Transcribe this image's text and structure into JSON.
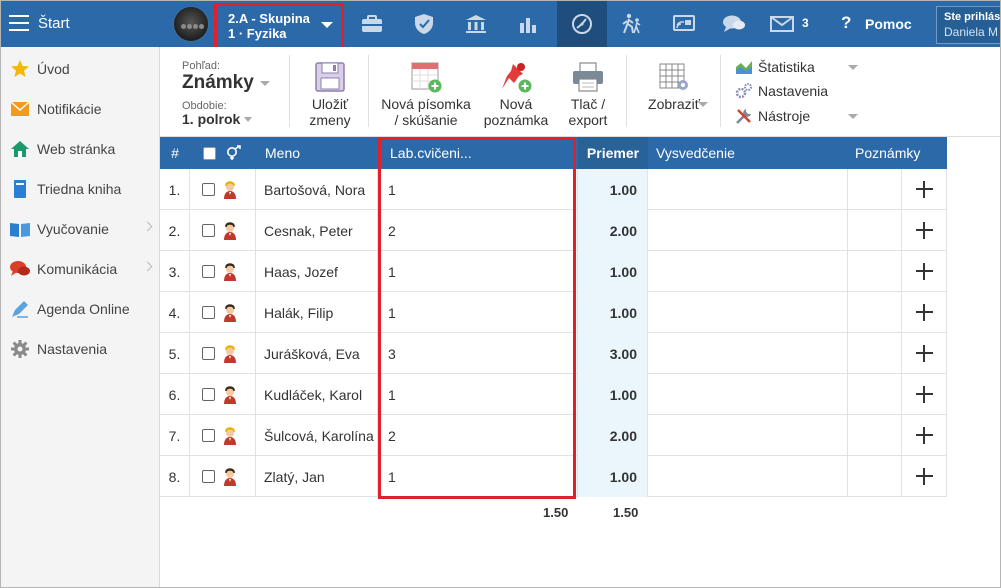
{
  "topbar": {
    "start_label": "Štart",
    "group_line1": "2.A - Skupina",
    "group_line2": "1 · Fyzika",
    "mail_count": "3",
    "help_label": "Pomoc",
    "user_line1": "Ste prihlás",
    "user_line2": "Daniela M",
    "accent_color": "#2b69a8",
    "highlight_color": "#e0202a",
    "icons": [
      "briefcase-icon",
      "shield-icon",
      "bank-icon",
      "bar-chart-icon",
      "gauge-icon",
      "walking-icon",
      "cast-icon",
      "chat-icon",
      "mail-icon",
      "help-icon"
    ]
  },
  "sidebar": {
    "items": [
      {
        "label": "Úvod",
        "icon": "star-icon",
        "has_submenu": false
      },
      {
        "label": "Notifikácie",
        "icon": "envelope-icon",
        "has_submenu": false
      },
      {
        "label": "Web stránka",
        "icon": "home-icon",
        "has_submenu": false
      },
      {
        "label": "Triedna kniha",
        "icon": "book-icon",
        "has_submenu": false
      },
      {
        "label": "Vyučovanie",
        "icon": "open-book-icon",
        "has_submenu": true
      },
      {
        "label": "Komunikácia",
        "icon": "chat-bubbles-icon",
        "has_submenu": true
      },
      {
        "label": "Agenda Online",
        "icon": "pen-icon",
        "has_submenu": false
      },
      {
        "label": "Nastavenia",
        "icon": "gear-icon",
        "has_submenu": false
      }
    ]
  },
  "ribbon": {
    "view_label": "Pohľad:",
    "view_value": "Známky",
    "period_label": "Obdobie:",
    "period_value": "1. polrok",
    "save_line1": "Uložiť",
    "save_line2": "zmeny",
    "new_test_line1": "Nová písomka",
    "new_test_line2": "/ skúšanie",
    "new_note_line1": "Nová",
    "new_note_line2": "poznámka",
    "print_line1": "Tlač /",
    "print_line2": "export",
    "show_label": "Zobraziť",
    "stats_label": "Štatistika",
    "settings_label": "Nastavenia",
    "tools_label": "Nástroje"
  },
  "grid": {
    "headers": {
      "num": "#",
      "name": "Meno",
      "lab": "Lab.cvičeni...",
      "avg": "Priemer",
      "report": "Vysvedčenie",
      "notes": "Poznámky"
    },
    "rows": [
      {
        "num": "1.",
        "name": "Bartošová, Nora",
        "lab": "1",
        "avg": "1.00",
        "gender": "female"
      },
      {
        "num": "2.",
        "name": "Cesnak, Peter",
        "lab": "2",
        "avg": "2.00",
        "gender": "male"
      },
      {
        "num": "3.",
        "name": "Haas, Jozef",
        "lab": "1",
        "avg": "1.00",
        "gender": "male"
      },
      {
        "num": "4.",
        "name": "Halák, Filip",
        "lab": "1",
        "avg": "1.00",
        "gender": "male"
      },
      {
        "num": "5.",
        "name": "Jurášková, Eva",
        "lab": "3",
        "avg": "3.00",
        "gender": "female"
      },
      {
        "num": "6.",
        "name": "Kudláček, Karol",
        "lab": "1",
        "avg": "1.00",
        "gender": "male"
      },
      {
        "num": "7.",
        "name": "Šulcová, Karolína",
        "lab": "2",
        "avg": "2.00",
        "gender": "female"
      },
      {
        "num": "8.",
        "name": "Zlatý, Jan",
        "lab": "1",
        "avg": "1.00",
        "gender": "male"
      }
    ],
    "footer": {
      "lab_avg": "1.50",
      "overall_avg": "1.50"
    }
  }
}
